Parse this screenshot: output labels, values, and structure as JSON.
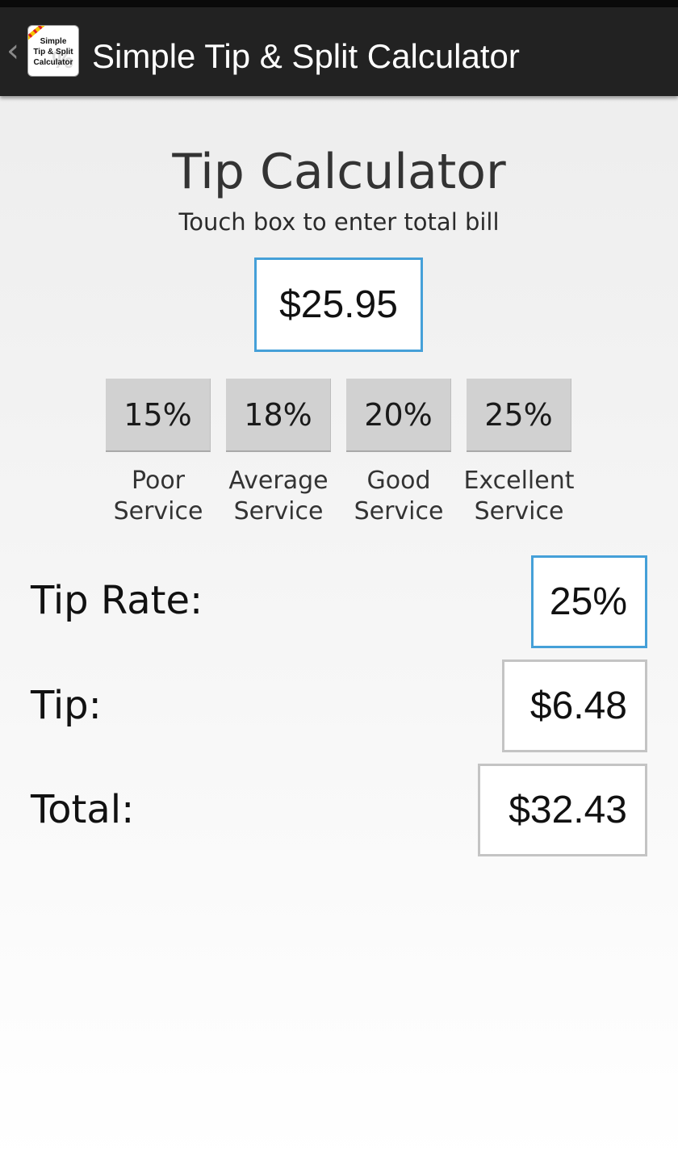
{
  "action_bar": {
    "back_glyph": "‹",
    "app_icon": {
      "label": "Simple\nTip & Split\nCalculator",
      "badge": "%",
      "icon": "tip-calculator-app-icon"
    },
    "title": "Simple Tip & Split Calculator"
  },
  "calculator": {
    "heading": "Tip Calculator",
    "instruction": "Touch box to enter total bill",
    "bill_value": "$25.95",
    "presets": [
      {
        "percent": "15%",
        "label_line1": "Poor",
        "label_line2": "Service"
      },
      {
        "percent": "18%",
        "label_line1": "Average",
        "label_line2": "Service"
      },
      {
        "percent": "20%",
        "label_line1": "Good",
        "label_line2": "Service"
      },
      {
        "percent": "25%",
        "label_line1": "Excellent",
        "label_line2": "Service"
      }
    ],
    "tip_rate": {
      "label": "Tip Rate:",
      "value": "25%"
    },
    "tip": {
      "label": "Tip:",
      "value": "$6.48"
    },
    "total": {
      "label": "Total:",
      "value": "$32.43"
    }
  },
  "colors": {
    "action_bar": "#222222",
    "focus_border": "#45a0d8",
    "button_bg": "#d1d1d1",
    "box_border": "#c4c4c4"
  }
}
